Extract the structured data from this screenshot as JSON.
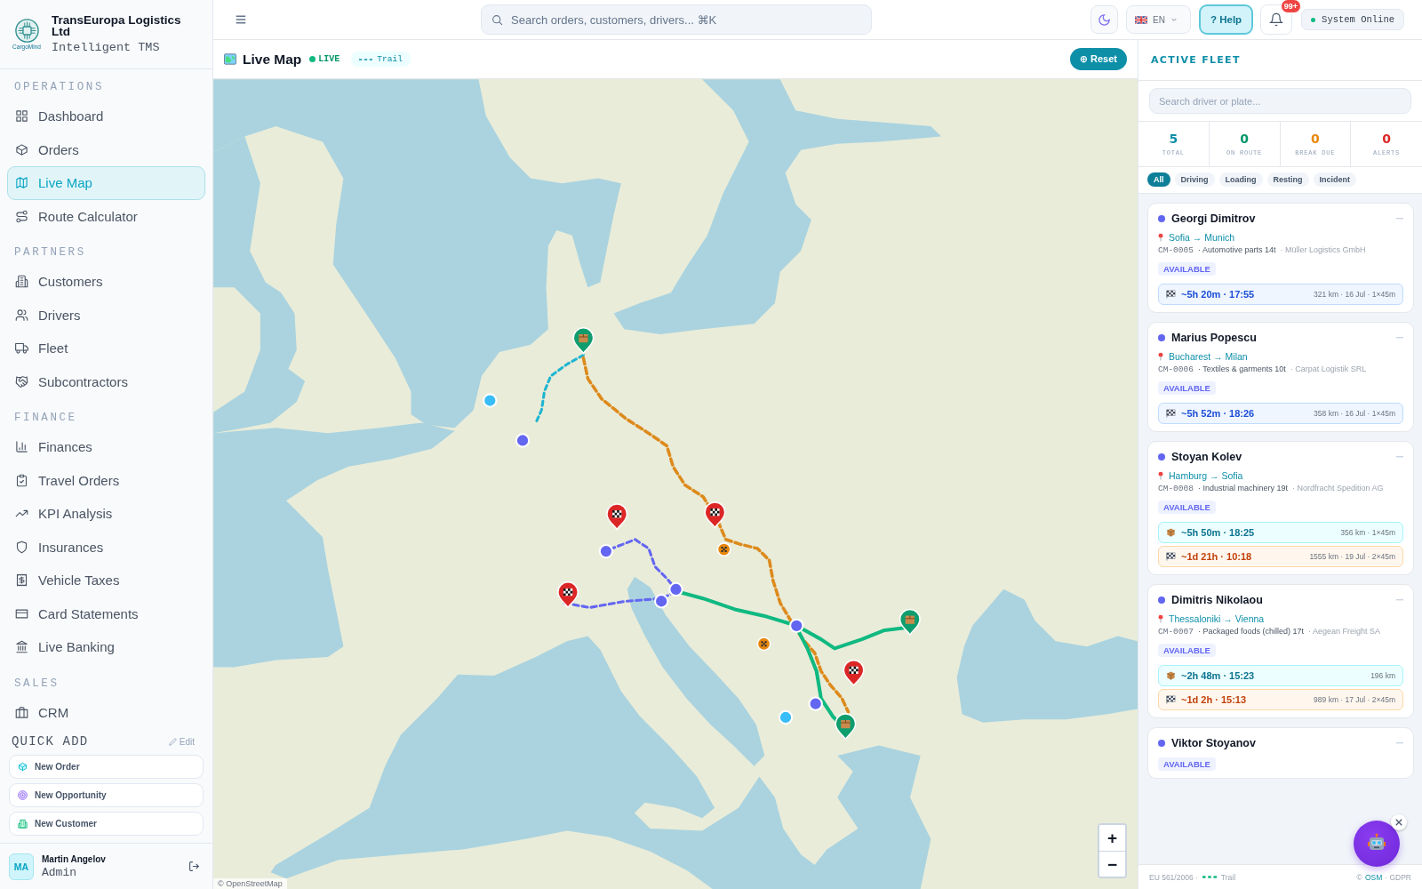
{
  "sidebar": {
    "brand": {
      "name": "TransEuropa Logistics Ltd",
      "tagline": "Intelligent TMS",
      "logo_caption": "CargoMind"
    },
    "nav_sections": [
      {
        "title": "OPERATIONS",
        "items": [
          {
            "label": "Dashboard",
            "selected": false
          },
          {
            "label": "Orders",
            "selected": false
          },
          {
            "label": "Live Map",
            "selected": true
          },
          {
            "label": "Route Calculator",
            "selected": false
          }
        ]
      },
      {
        "title": "PARTNERS",
        "items": [
          {
            "label": "Customers",
            "selected": false
          },
          {
            "label": "Drivers",
            "selected": false
          },
          {
            "label": "Fleet",
            "selected": false
          },
          {
            "label": "Subcontractors",
            "selected": false
          }
        ]
      },
      {
        "title": "FINANCE",
        "items": [
          {
            "label": "Finances",
            "selected": false
          },
          {
            "label": "Travel Orders",
            "selected": false
          },
          {
            "label": "KPI Analysis",
            "selected": false
          },
          {
            "label": "Insurances",
            "selected": false
          },
          {
            "label": "Vehicle Taxes",
            "selected": false
          },
          {
            "label": "Card Statements",
            "selected": false
          },
          {
            "label": "Live Banking",
            "selected": false
          }
        ]
      },
      {
        "title": "SALES",
        "items": [
          {
            "label": "CRM",
            "selected": false
          }
        ]
      }
    ],
    "quick_add": {
      "title": "QUICK ADD",
      "edit_label": "Edit",
      "items": [
        {
          "label": "New Order",
          "kind": "order"
        },
        {
          "label": "New Opportunity",
          "kind": "opportunity"
        },
        {
          "label": "New Customer",
          "kind": "customer"
        }
      ]
    },
    "user": {
      "initials": "MA",
      "name": "Martin Angelov",
      "role": "Admin"
    }
  },
  "topbar": {
    "search": {
      "placeholder": "Search orders, customers, drivers... ⌘K"
    },
    "language": "EN",
    "help_label": "? Help",
    "notifications_badge": "99+",
    "status": "System Online"
  },
  "map_panel": {
    "title": "Live Map",
    "live_label": "LIVE",
    "trail_label": "Trail",
    "reset_label": "⊕ Reset",
    "attribution": "© OpenStreetMap",
    "zoom_in_label": "+",
    "zoom_out_label": "−"
  },
  "fleet": {
    "title": "ACTIVE FLEET",
    "search": {
      "placeholder": "Search driver or plate..."
    },
    "stats": [
      {
        "value": "5",
        "label": "TOTAL",
        "kind": "total"
      },
      {
        "value": "0",
        "label": "ON ROUTE",
        "kind": "on_route"
      },
      {
        "value": "0",
        "label": "BREAK DUE",
        "kind": "break_due"
      },
      {
        "value": "0",
        "label": "ALERTS",
        "kind": "alerts"
      }
    ],
    "filters": [
      {
        "label": "All",
        "selected": true
      },
      {
        "label": "Driving",
        "selected": false
      },
      {
        "label": "Loading",
        "selected": false
      },
      {
        "label": "Resting",
        "selected": false
      },
      {
        "label": "Incident",
        "selected": false
      }
    ],
    "drivers": [
      {
        "name": "Georgi Dimitrov",
        "route": "Sofia → Munich",
        "plate": "CM-0005",
        "cargo": "· Automotive parts 14t",
        "client": "· Müller Logistics GmbH",
        "status": "AVAILABLE",
        "etas": [
          {
            "kind": "delivery",
            "eta": "~5h 20m · 17:55",
            "details": "321 km · 16 Jul · 1×45m"
          }
        ]
      },
      {
        "name": "Marius Popescu",
        "route": "Bucharest → Milan",
        "plate": "CM-0006",
        "cargo": "· Textiles & garments 10t",
        "client": "· Carpat Logistik SRL",
        "status": "AVAILABLE",
        "etas": [
          {
            "kind": "delivery",
            "eta": "~5h 52m · 18:26",
            "details": "358 km · 16 Jul · 1×45m"
          }
        ]
      },
      {
        "name": "Stoyan Kolev",
        "route": "Hamburg → Sofia",
        "plate": "CM-0008",
        "cargo": "· Industrial machinery 19t",
        "client": "· Nordfracht Spedition AG",
        "status": "AVAILABLE",
        "etas": [
          {
            "kind": "pickup",
            "eta": "~5h 50m · 18:25",
            "details": "356 km · 1×45m"
          },
          {
            "kind": "onward_delivery",
            "eta": "~1d 21h · 10:18",
            "details": "1555 km · 19 Jul · 2×45m"
          }
        ]
      },
      {
        "name": "Dimitris Nikolaou",
        "route": "Thessaloniki → Vienna",
        "plate": "CM-0007",
        "cargo": "· Packaged foods (chilled) 17t",
        "client": "· Aegean Freight SA",
        "status": "AVAILABLE",
        "etas": [
          {
            "kind": "pickup",
            "eta": "~2h 48m · 15:23",
            "details": "196 km"
          },
          {
            "kind": "onward_delivery",
            "eta": "~1d 2h · 15:13",
            "details": "989 km · 17 Jul · 2×45m"
          }
        ]
      },
      {
        "name": "Viktor Stoyanov",
        "status": "AVAILABLE"
      }
    ],
    "footer": {
      "regulation": "EU 561/2006 ·",
      "trail_label": "Trail",
      "credit_prefix": "©",
      "credit_link": "OSM",
      "credit_suffix": "· GDPR"
    }
  }
}
